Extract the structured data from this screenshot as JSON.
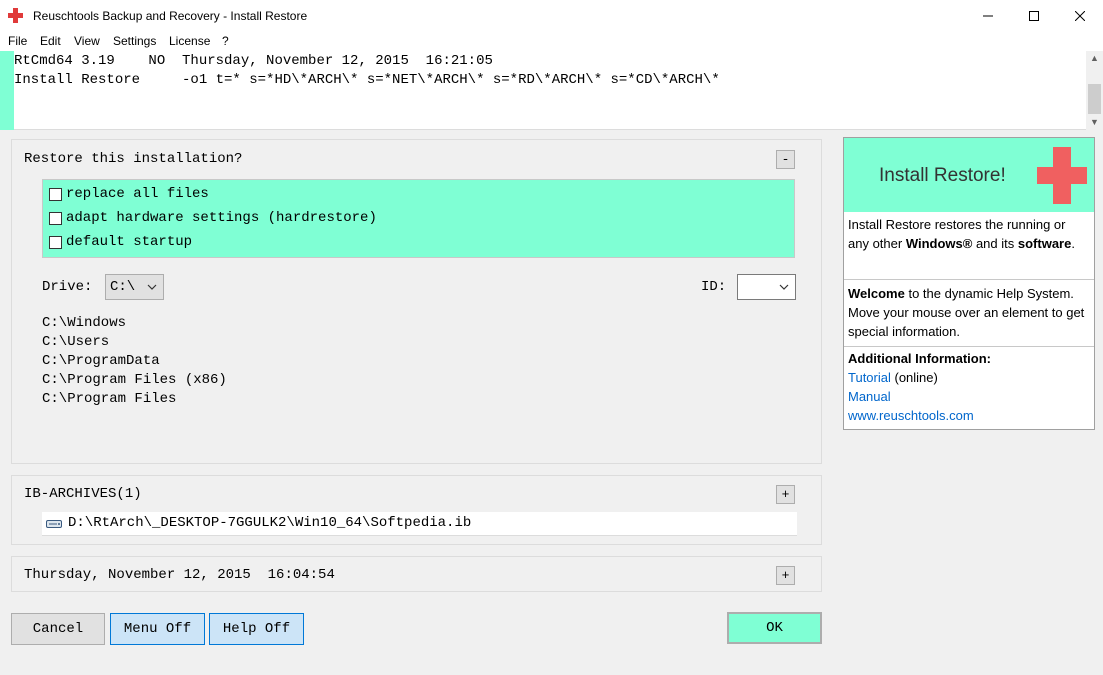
{
  "window": {
    "title": "Reuschtools Backup and Recovery - Install Restore"
  },
  "menu": [
    "File",
    "Edit",
    "View",
    "Settings",
    "License",
    "?"
  ],
  "console": {
    "line1": "RtCmd64 3.19    NO  Thursday, November 12, 2015  16:21:05",
    "line2": "Install Restore     -o1 t=* s=*HD\\*ARCH\\* s=*NET\\*ARCH\\* s=*RD\\*ARCH\\* s=*CD\\*ARCH\\*"
  },
  "restore_panel": {
    "title": "Restore this installation?",
    "toggle": "-",
    "options": [
      "replace all files",
      "adapt hardware settings (hardrestore)",
      "default startup"
    ],
    "drive_label": "Drive:",
    "drive_value": "C:\\",
    "id_label": "ID:",
    "id_value": "",
    "paths": [
      "C:\\Windows",
      "C:\\Users",
      "C:\\ProgramData",
      "C:\\Program Files (x86)",
      "C:\\Program Files"
    ]
  },
  "archives_panel": {
    "title": "IB-ARCHIVES(1)",
    "toggle": "+",
    "items": [
      "D:\\RtArch\\_DESKTOP-7GGULK2\\Win10_64\\Softpedia.ib"
    ]
  },
  "date_panel": {
    "title": "Thursday, November 12, 2015  16:04:54",
    "toggle": "+"
  },
  "buttons": {
    "cancel": "Cancel",
    "menu_off": "Menu Off",
    "help_off": "Help Off",
    "ok": "OK"
  },
  "help": {
    "title": "Install Restore!",
    "intro_1": "Install Restore restores the running or any other ",
    "intro_bold_1": "Windows®",
    "intro_2": " and its ",
    "intro_bold_2": "software",
    "intro_3": ".",
    "welcome_bold": "Welcome",
    "welcome_rest": " to the dynamic Help System. Move your mouse over an element to get special information.",
    "additional_title": "Additional Information:",
    "tutorial_link": "Tutorial",
    "tutorial_suffix": " (online)",
    "manual_link": "Manual",
    "website_link": "www.reuschtools.com"
  },
  "colors": {
    "accent": "#7fffd4",
    "cross": "#f06060",
    "link": "#0066cc"
  }
}
